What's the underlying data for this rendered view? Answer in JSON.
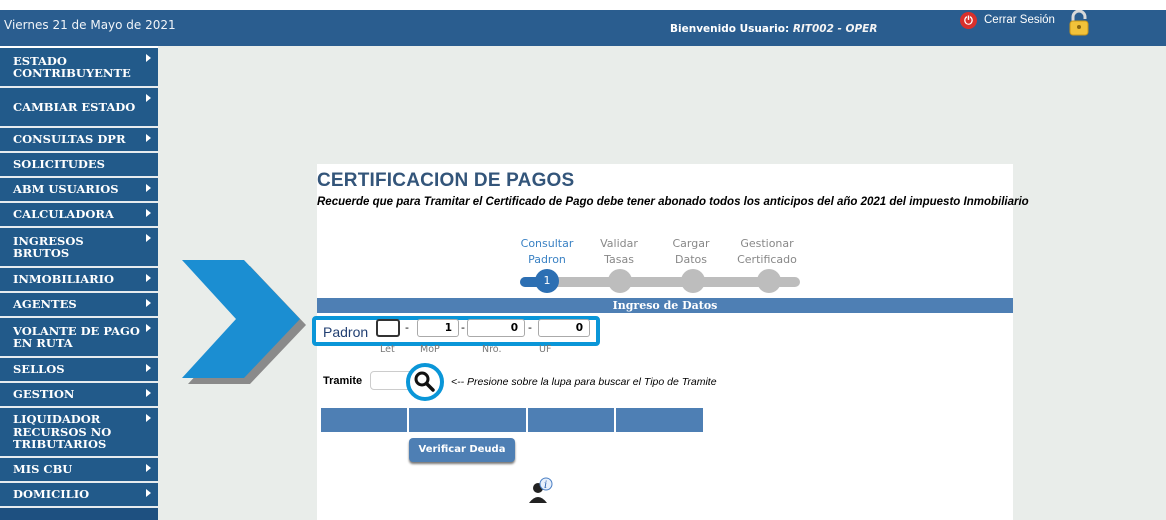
{
  "header": {
    "date": "Viernes 21 de Mayo de 2021",
    "welcome_label": "Bienvenido Usuario:",
    "user": "RIT002 - OPER",
    "logout_label": "Cerrar Sesión"
  },
  "sidebar": {
    "items": [
      {
        "label": "ESTADO CONTRIBUYENTE",
        "submenu": true
      },
      {
        "label": "CAMBIAR ESTADO",
        "submenu": true
      },
      {
        "label": "CONSULTAS DPR",
        "submenu": true
      },
      {
        "label": "SOLICITUDES",
        "submenu": false
      },
      {
        "label": "ABM USUARIOS",
        "submenu": true
      },
      {
        "label": "CALCULADORA",
        "submenu": true
      },
      {
        "label": "INGRESOS BRUTOS",
        "submenu": true
      },
      {
        "label": "INMOBILIARIO",
        "submenu": true
      },
      {
        "label": "AGENTES",
        "submenu": true
      },
      {
        "label": "VOLANTE DE PAGO EN RUTA",
        "submenu": true
      },
      {
        "label": "SELLOS",
        "submenu": true
      },
      {
        "label": "GESTION",
        "submenu": true
      },
      {
        "label": "LIQUIDADOR RECURSOS NO TRIBUTARIOS",
        "submenu": true
      },
      {
        "label": "MIS CBU",
        "submenu": true
      },
      {
        "label": "DOMICILIO",
        "submenu": true
      }
    ]
  },
  "main": {
    "title": "CERTIFICACION DE PAGOS",
    "subtitle": "Recuerde que para Tramitar el Certificado de Pago debe tener abonado todos los anticipos del año 2021 del impuesto Inmobiliario",
    "steps": [
      {
        "line1": "Consultar",
        "line2": "Padron",
        "active": true,
        "number": "1"
      },
      {
        "line1": "Validar",
        "line2": "Tasas",
        "active": false
      },
      {
        "line1": "Cargar",
        "line2": "Datos",
        "active": false
      },
      {
        "line1": "Gestionar",
        "line2": "Certificado",
        "active": false
      }
    ],
    "section_title": "Ingreso de Datos",
    "padron": {
      "label": "Padron",
      "let_value": "",
      "mop_value": "1",
      "nro_value": "0",
      "uf_value": "0",
      "sublabels": {
        "let": "Let",
        "mop": "MoP",
        "nro": "Nro.",
        "uf": "UF"
      }
    },
    "tramite": {
      "label": "Tramite",
      "value": "",
      "hint": "<-- Presione sobre la lupa para buscar el Tipo de Tramite"
    },
    "verify_button": "Verificar Deuda"
  },
  "colors": {
    "topbar": "#2a5d8f",
    "sidebar": "#225a8a",
    "accent": "#0a96d8",
    "section": "#4e7fb4"
  }
}
